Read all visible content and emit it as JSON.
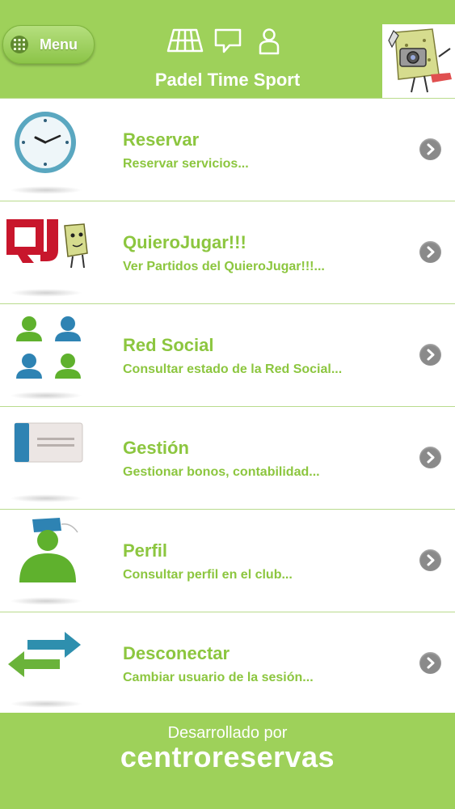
{
  "header": {
    "menu_label": "Menu",
    "title": "Padel Time Sport",
    "icons": [
      "court-icon",
      "chat-bubble-icon",
      "user-icon"
    ]
  },
  "items": [
    {
      "title": "Reservar",
      "subtitle": "Reservar servicios...",
      "icon": "clock-icon"
    },
    {
      "title": "QuieroJugar!!!",
      "subtitle": "Ver Partidos del QuieroJugar!!!...",
      "icon": "quierojugar-logo-icon"
    },
    {
      "title": "Red Social",
      "subtitle": "Consultar estado de la Red Social...",
      "icon": "social-network-icon"
    },
    {
      "title": "Gestión",
      "subtitle": "Gestionar bonos, contabilidad...",
      "icon": "card-icon"
    },
    {
      "title": "Perfil",
      "subtitle": "Consultar perfil en el club...",
      "icon": "profile-icon"
    },
    {
      "title": "Desconectar",
      "subtitle": "Cambiar usuario de la sesión...",
      "icon": "swap-arrows-icon"
    }
  ],
  "footer": {
    "developed_by": "Desarrollado por",
    "brand": "centroreservas"
  },
  "colors": {
    "brand_green": "#9ed15a",
    "text_green": "#8cc63f",
    "chevron_gray": "#8a8a8a"
  }
}
